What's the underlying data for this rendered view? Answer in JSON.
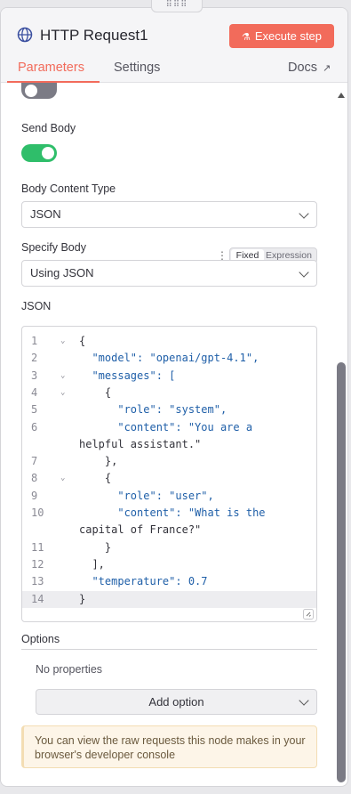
{
  "header": {
    "title": "HTTP Request1",
    "execute_label": "Execute step",
    "tabs": [
      "Parameters",
      "Settings"
    ],
    "docs_label": "Docs",
    "accent_color": "#f26b5b"
  },
  "fields": {
    "send_body_label": "Send Body",
    "send_body_on": true,
    "body_content_type_label": "Body Content Type",
    "body_content_type_value": "JSON",
    "specify_body_label": "Specify Body",
    "specify_body_value": "Using JSON",
    "mode_fixed": "Fixed",
    "mode_expression": "Expression",
    "json_label": "JSON"
  },
  "editor": {
    "lines": [
      {
        "n": "1",
        "fold": true,
        "text": "{"
      },
      {
        "n": "2",
        "fold": false,
        "text": "  \"model\": \"openai/gpt-4.1\","
      },
      {
        "n": "3",
        "fold": true,
        "text": "  \"messages\": ["
      },
      {
        "n": "4",
        "fold": true,
        "text": "    {"
      },
      {
        "n": "5",
        "fold": false,
        "text": "      \"role\": \"system\","
      },
      {
        "n": "6",
        "fold": false,
        "text": "      \"content\": \"You are a"
      },
      {
        "n": "",
        "fold": false,
        "text": "helpful assistant.\""
      },
      {
        "n": "7",
        "fold": false,
        "text": "    },"
      },
      {
        "n": "8",
        "fold": true,
        "text": "    {"
      },
      {
        "n": "9",
        "fold": false,
        "text": "      \"role\": \"user\","
      },
      {
        "n": "10",
        "fold": false,
        "text": "      \"content\": \"What is the"
      },
      {
        "n": "",
        "fold": false,
        "text": "capital of France?\""
      },
      {
        "n": "11",
        "fold": false,
        "text": "    }"
      },
      {
        "n": "12",
        "fold": false,
        "text": "  ],"
      },
      {
        "n": "13",
        "fold": false,
        "text": "  \"temperature\": 0.7"
      },
      {
        "n": "14",
        "fold": false,
        "text": "}"
      }
    ]
  },
  "options": {
    "label": "Options",
    "empty_text": "No properties",
    "add_label": "Add option"
  },
  "notice": {
    "text": "You can view the raw requests this node makes in your browser's developer console"
  }
}
